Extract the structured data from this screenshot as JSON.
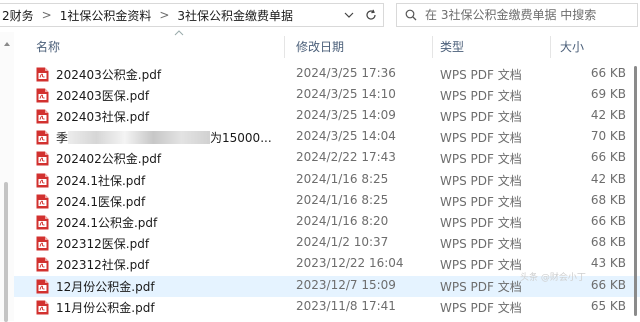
{
  "address_bar": {
    "crumbs": [
      "2财务",
      "1社保公积金资料",
      "3社保公积金缴费单据"
    ],
    "separator": ">"
  },
  "search": {
    "placeholder": "在 3社保公积金缴费单据 中搜索"
  },
  "columns": {
    "name": "名称",
    "date": "修改日期",
    "type": "类型",
    "size": "大小"
  },
  "files": [
    {
      "name": "202403公积金.pdf",
      "date": "2024/3/25 17:36",
      "type": "WPS PDF 文档",
      "size": "66 KB"
    },
    {
      "name": "202403医保.pdf",
      "date": "2024/3/25 14:10",
      "type": "WPS PDF 文档",
      "size": "69 KB"
    },
    {
      "name": "202403社保.pdf",
      "date": "2024/3/25 14:09",
      "type": "WPS PDF 文档",
      "size": "42 KB"
    },
    {
      "name_prefix": "季",
      "name_suffix": "为15000...",
      "date": "2024/3/25 14:04",
      "type": "WPS PDF 文档",
      "size": "70 KB",
      "redacted": true
    },
    {
      "name": "202402公积金.pdf",
      "date": "2024/2/22 17:43",
      "type": "WPS PDF 文档",
      "size": "66 KB"
    },
    {
      "name": "2024.1社保.pdf",
      "date": "2024/1/16 8:25",
      "type": "WPS PDF 文档",
      "size": "42 KB"
    },
    {
      "name": "2024.1医保.pdf",
      "date": "2024/1/16 8:25",
      "type": "WPS PDF 文档",
      "size": "68 KB"
    },
    {
      "name": "2024.1公积金.pdf",
      "date": "2024/1/16 8:20",
      "type": "WPS PDF 文档",
      "size": "66 KB"
    },
    {
      "name": "202312医保.pdf",
      "date": "2024/1/2 10:37",
      "type": "WPS PDF 文档",
      "size": "68 KB"
    },
    {
      "name": "202312社保.pdf",
      "date": "2023/12/22 16:04",
      "type": "WPS PDF 文档",
      "size": "43 KB"
    },
    {
      "name": "12月份公积金.pdf",
      "date": "2023/12/7 15:09",
      "type": "WPS PDF 文档",
      "size": "66 KB",
      "selected": true
    },
    {
      "name": "11月份公积金.pdf",
      "date": "2023/11/8 17:41",
      "type": "WPS PDF 文档",
      "size": "65 KB"
    }
  ],
  "watermark": "头条 @财会小丁",
  "colors": {
    "header_text": "#4c607a",
    "selected_row": "#e5f3ff",
    "pdf_icon": "#c8282e"
  },
  "icons": {
    "file": "pdf-file-icon",
    "search": "search-icon",
    "refresh": "refresh-icon",
    "dropdown": "chevron-down-icon"
  }
}
